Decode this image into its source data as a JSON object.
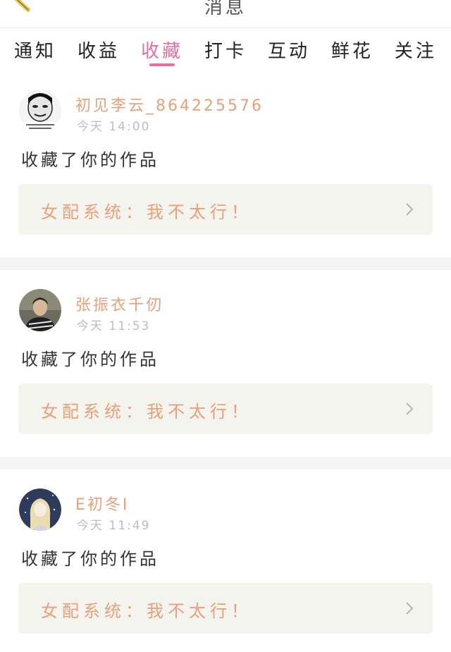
{
  "header": {
    "title": "消息"
  },
  "tabs": [
    {
      "label": "通知"
    },
    {
      "label": "收益"
    },
    {
      "label": "收藏"
    },
    {
      "label": "打卡"
    },
    {
      "label": "互动"
    },
    {
      "label": "鲜花"
    },
    {
      "label": "关注"
    }
  ],
  "active_tab": "收藏",
  "notifications": [
    {
      "username": "初见李云_864225576",
      "time": "今天 14:00",
      "action": "收藏了你的作品",
      "work_title": "女配系统：我不太行！",
      "avatar_icon": "meme-face-avatar"
    },
    {
      "username": "张振衣千仞",
      "time": "今天 11:53",
      "action": "收藏了你的作品",
      "work_title": "女配系统：我不太行！",
      "avatar_icon": "photo-avatar"
    },
    {
      "username": "E初冬I",
      "time": "今天 11:49",
      "action": "收藏了你的作品",
      "work_title": "女配系统：我不太行！",
      "avatar_icon": "anime-girl-avatar"
    }
  ],
  "colors": {
    "accent": "#e06fa4",
    "username": "#e7a07a",
    "time": "#bdbdbd",
    "work_bg": "#f4f4ef"
  }
}
